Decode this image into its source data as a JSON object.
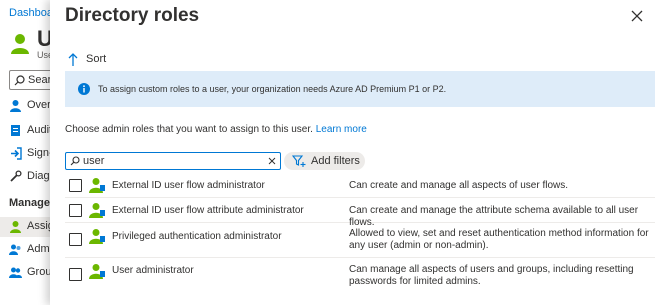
{
  "background": {
    "breadcrumb": "Dashboard",
    "title": "U",
    "subtitle": "Use",
    "search_label": "Search",
    "nav_top": [
      {
        "label": "Overview",
        "icon": "person-icon"
      },
      {
        "label": "Audit logs",
        "icon": "audit-log-icon"
      },
      {
        "label": "Sign-ins",
        "icon": "sign-in-icon"
      },
      {
        "label": "Diagnose",
        "icon": "wrench-icon"
      }
    ],
    "section_label": "Manage",
    "nav_manage": [
      {
        "label": "Assigned roles",
        "icon": "person-icon"
      },
      {
        "label": "Administrative units",
        "icon": "admin-units-icon"
      },
      {
        "label": "Groups",
        "icon": "groups-icon"
      }
    ]
  },
  "panel": {
    "title": "Directory roles",
    "sort_label": "Sort",
    "info_text": "To assign custom roles to a user, your organization needs Azure AD Premium P1 or P2.",
    "choose_text": "Choose admin roles that you want to assign to this user.",
    "learn_more": "Learn more",
    "search_value": "user",
    "add_filters_label": "Add filters",
    "roles": [
      {
        "name": "External ID user flow administrator",
        "description": "Can create and manage all aspects of user flows."
      },
      {
        "name": "External ID user flow attribute administrator",
        "description": "Can create and manage the attribute schema available to all user flows."
      },
      {
        "name": "Privileged authentication administrator",
        "description": "Allowed to view, set and reset authentication method information for any user (admin or non-admin)."
      },
      {
        "name": "User administrator",
        "description": "Can manage all aspects of users and groups, including resetting passwords for limited admins."
      }
    ]
  },
  "colors": {
    "accent": "#0078d4",
    "info_bg": "#deecf9",
    "role_icon_green": "#6bb700"
  }
}
